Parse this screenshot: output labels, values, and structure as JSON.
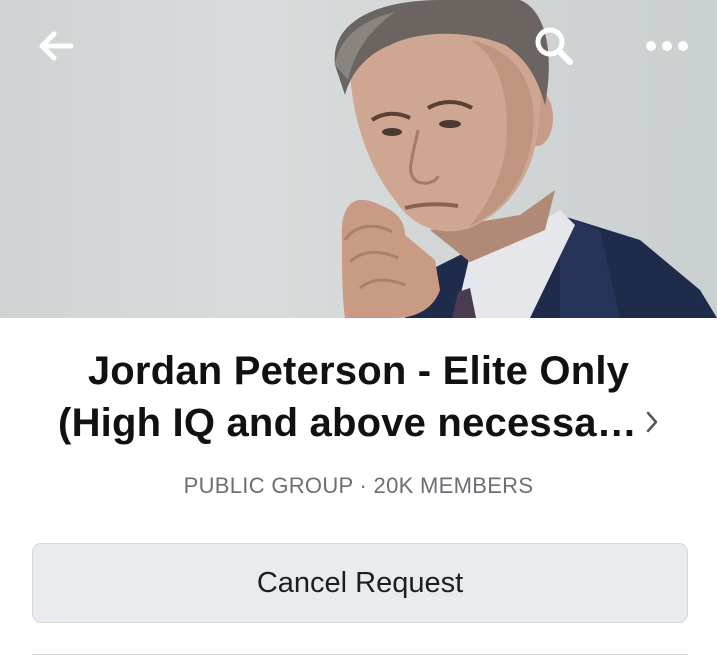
{
  "header": {
    "back_icon": "back-arrow-icon",
    "search_icon": "search-icon",
    "more_icon": "more-dots-icon",
    "cover_photo": "group-cover-photo"
  },
  "group": {
    "title_line1": "Jordan Peterson - Elite Only",
    "title_line2": "(High IQ and above necessa…",
    "subtitle": "PUBLIC GROUP · 20K MEMBERS"
  },
  "actions": {
    "cancel_request_label": "Cancel Request"
  },
  "colors": {
    "button_bg": "#e9ebee",
    "title_text": "#111111",
    "subtitle_text": "#6b6f74"
  }
}
